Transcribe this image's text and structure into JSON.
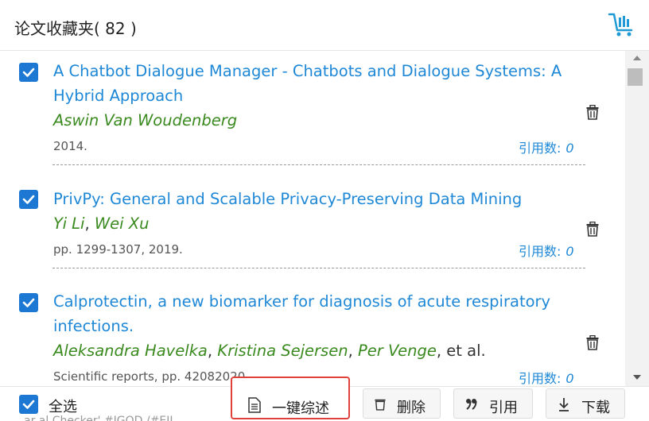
{
  "header": {
    "title": "论文收藏夹( 82 )"
  },
  "papers": [
    {
      "title": "A Chatbot Dialogue Manager - Chatbots and Dialogue Systems: A Hybrid Approach",
      "authors": [
        "Aswin Van Woudenberg"
      ],
      "et_al": "",
      "meta": "2014.",
      "cite_label": "引用数:",
      "cite_count": "0",
      "checked": true
    },
    {
      "title": "PrivPy: General and Scalable Privacy-Preserving Data Mining",
      "authors": [
        "Yi Li",
        "Wei Xu"
      ],
      "et_al": "",
      "meta": "pp. 1299-1307, 2019.",
      "cite_label": "引用数:",
      "cite_count": "0",
      "checked": true
    },
    {
      "title": "Calprotectin, a new biomarker for diagnosis of acute respiratory infections.",
      "authors": [
        "Aleksandra Havelka",
        "Kristina Sejersen",
        "Per Venge"
      ],
      "et_al": ", et al.",
      "meta": "Scientific reports, pp. 42082020.",
      "cite_label": "引用数:",
      "cite_count": "0",
      "checked": true
    }
  ],
  "footer": {
    "select_all_label": "全选",
    "summary_label": "一键综述",
    "delete_label": "删除",
    "cite_label": "引用",
    "download_label": "下载"
  },
  "below_text": "ar al Checker' #IGOD /#EII"
}
